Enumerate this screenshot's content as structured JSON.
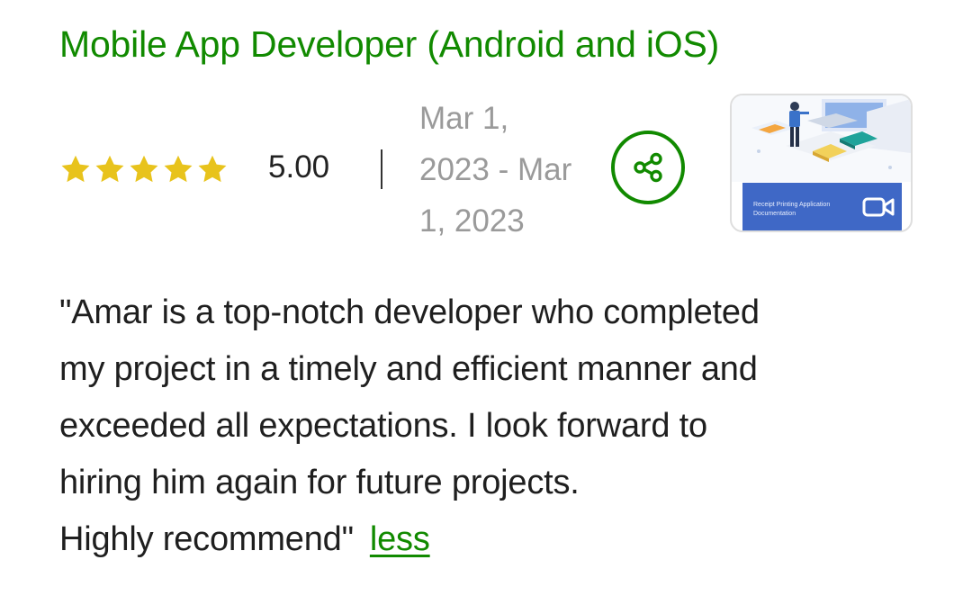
{
  "job": {
    "title": "Mobile App Developer (Android and iOS)"
  },
  "rating": {
    "stars": 5,
    "max_stars": 5,
    "value": "5.00",
    "star_color": "#e8c31c"
  },
  "dates": {
    "line1": "Mar 1,",
    "line2": "2023 - Mar",
    "line3": "1, 2023"
  },
  "share": {
    "icon": "share-icon",
    "color": "#118a00"
  },
  "thumbnail": {
    "caption_line1": "Receipt Printing Application",
    "caption_line2": "Documentation",
    "icon": "video-camera-icon",
    "bar_color": "#3f68c6"
  },
  "review": {
    "lines": [
      "\"Amar is a top-notch developer who completed",
      "my project in a timely and efficient manner and",
      "exceeded all expectations. I look forward to",
      "hiring him again for future projects.",
      "Highly recommend\""
    ],
    "less_label": "less"
  }
}
